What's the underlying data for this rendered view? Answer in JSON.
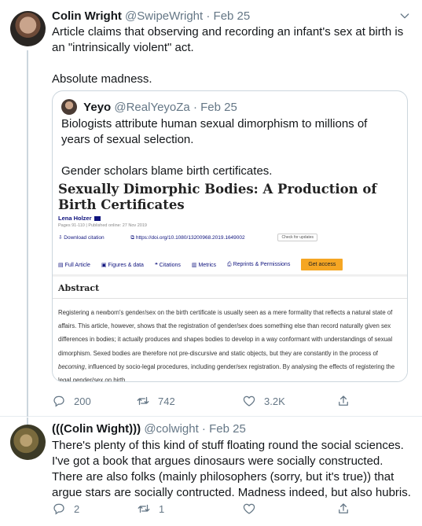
{
  "tweet1": {
    "name": "Colin Wright",
    "handle": "@SwipeWright",
    "sep": "·",
    "date": "Feb 25",
    "lines": [
      "Article claims that observing and recording an infant's sex at birth is an \"intrinsically violent\" act.",
      "Absolute madness."
    ],
    "quote": {
      "name": "Yeyo",
      "handle": "@RealYeyoZa",
      "sep": "·",
      "date": "Feb 25",
      "lines": [
        "Biologists attribute human sexual dimorphism to millions of years of sexual selection.",
        "Gender scholars blame birth certificates."
      ],
      "article": {
        "title": "Sexually Dimorphic Bodies: A Production of Birth Certificates",
        "author": "Lena Holzer",
        "meta": "Pages 91-110 | Published online: 27 Nov 2019",
        "download": "Download citation",
        "doi": "https://doi.org/10.1080/13200968.2019.1649002",
        "check": "Check for updates",
        "tabs": [
          "Full Article",
          "Figures & data",
          "Citations",
          "Metrics",
          "Reprints & Permissions"
        ],
        "access": "Get access",
        "abstract_heading": "Abstract",
        "abstract_part1": "Registering a newborn's gender/sex on the birth certificate is usually seen as a mere formality that reflects a natural state of affairs. This article, however, shows that the registration of gender/sex does something else than record naturally given sex differences in bodies; it actually produces and shapes bodies to develop in a way conformant with understandings of sexual dimorphism. Sexed bodies are therefore not pre-discursive and static objects, but they are constantly in the process of ",
        "abstract_italic": "becoming",
        "abstract_part2": ", influenced by socio-legal procedures, including gender/sex registration. By analysing the effects of registering the legal gender/sex on birth"
      }
    },
    "replies": "200",
    "retweets": "742",
    "likes": "3.2K"
  },
  "tweet2": {
    "name": "(((Colin Wight)))",
    "handle": "@colwight",
    "sep": "·",
    "date": "Feb 25",
    "text": "There's plenty of this kind of stuff floating round the social sciences. I've got a book that argues dinosaurs were socially constructed. There are also folks (mainly philosophers (sorry, but it's true)) that argue stars are socially contructed. Madness indeed, but also hubris.",
    "replies": "2",
    "retweets": "1",
    "likes": ""
  },
  "icons": {
    "caret": "chevron-down-icon",
    "reply": "reply-icon",
    "retweet": "retweet-icon",
    "like": "like-icon",
    "share": "share-icon"
  },
  "colors": {
    "secondary_text": "#657786",
    "border": "#ccd6dd",
    "journal_link": "#10147e",
    "access_button": "#f5a623"
  }
}
